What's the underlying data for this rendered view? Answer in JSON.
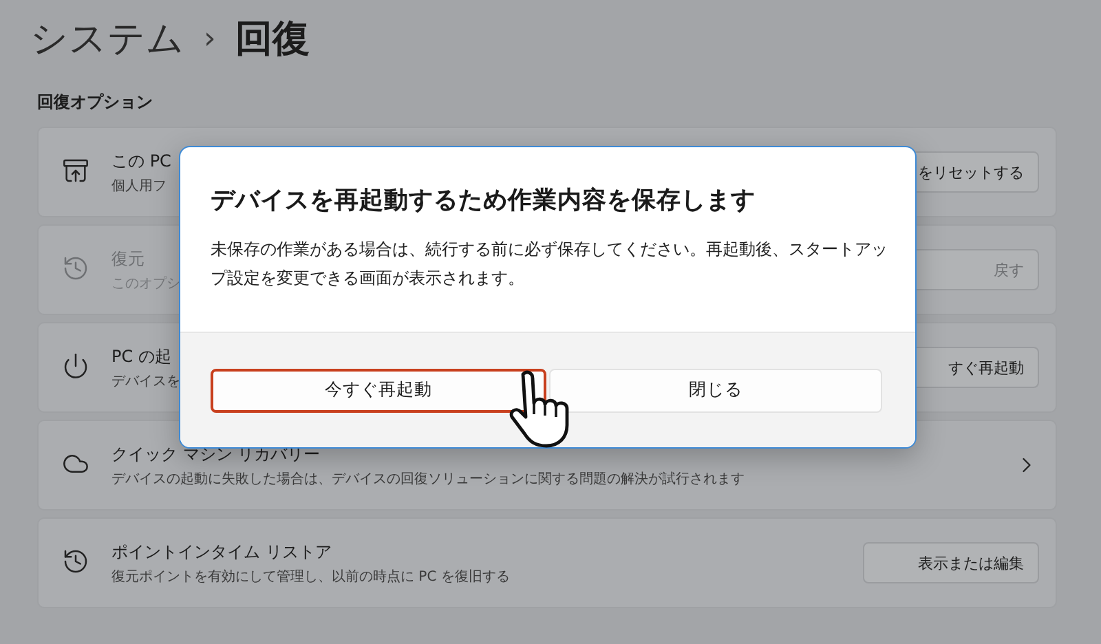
{
  "header": {
    "parent": "システム",
    "separator": "›",
    "title": "回復"
  },
  "section_label": "回復オプション",
  "options": [
    {
      "title": "この PC",
      "subtitle": "個人用フ",
      "disabled": false,
      "control": {
        "kind": "button",
        "label": "をリセットする"
      }
    },
    {
      "title": "復元",
      "subtitle": "このオプシ",
      "disabled": true,
      "control": {
        "kind": "button",
        "label": "戻す"
      }
    },
    {
      "title": "PC の起",
      "subtitle": "デバイスを",
      "disabled": false,
      "control": {
        "kind": "button",
        "label": "すぐ再起動"
      }
    },
    {
      "title": "クイック マシン リカバリー",
      "subtitle": "デバイスの起動に失敗した場合は、デバイスの回復ソリューションに関する問題の解決が試行されます",
      "disabled": false,
      "control": {
        "kind": "chevron"
      }
    },
    {
      "title": "ポイントインタイム リストア",
      "subtitle": "復元ポイントを有効にして管理し、以前の時点に PC を復旧する",
      "disabled": false,
      "control": {
        "kind": "button",
        "label": "表示または編集"
      }
    }
  ],
  "dialog": {
    "title": "デバイスを再起動するため作業内容を保存します",
    "body": "未保存の作業がある場合は、続行する前に必ず保存してください。再起動後、スタートアップ設定を変更できる画面が表示されます。",
    "buttons": [
      {
        "label": "今すぐ再起動",
        "highlighted": true
      },
      {
        "label": "閉じる",
        "highlighted": false
      }
    ]
  }
}
